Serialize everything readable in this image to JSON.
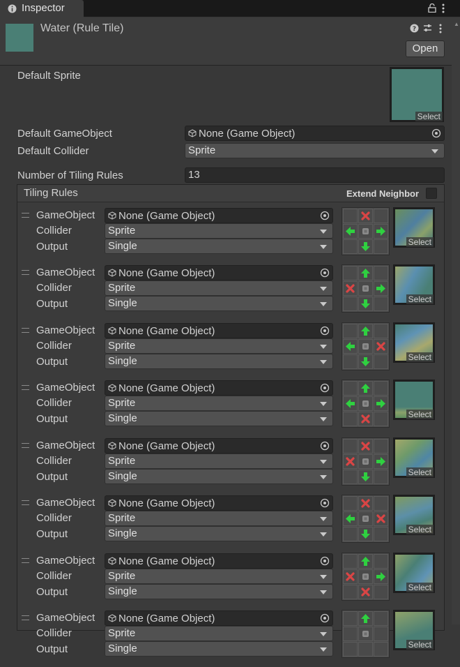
{
  "tab": {
    "label": "Inspector",
    "lock_icon": "lock-icon",
    "menu_icon": "kebab-menu-icon"
  },
  "header": {
    "title": "Water (Rule Tile)",
    "open_label": "Open",
    "icons": [
      "help-icon",
      "presets-icon",
      "kebab-menu-icon"
    ],
    "thumb_color": "#4a7f75"
  },
  "fields": {
    "default_sprite_label": "Default Sprite",
    "default_gameobject_label": "Default GameObject",
    "default_gameobject_value": "None (Game Object)",
    "default_collider_label": "Default Collider",
    "default_collider_value": "Sprite",
    "num_rules_label": "Number of Tiling Rules",
    "num_rules_value": "13",
    "select_label": "Select"
  },
  "rules_section": {
    "title": "Tiling Rules",
    "extend_label": "Extend Neighbor",
    "extend_checked": false
  },
  "rule_labels": {
    "gameobject": "GameObject",
    "collider": "Collider",
    "output": "Output"
  },
  "rules": [
    {
      "gameobject": "None (Game Object)",
      "collider": "Sprite",
      "output": "Single",
      "select": "Select",
      "neighbors": [
        "none",
        "x",
        "none",
        "arrow-left",
        "center",
        "arrow-right",
        "none",
        "arrow-down",
        "none"
      ],
      "sprite": "water-edge-1"
    },
    {
      "gameobject": "None (Game Object)",
      "collider": "Sprite",
      "output": "Single",
      "select": "Select",
      "neighbors": [
        "none",
        "arrow-up",
        "none",
        "x",
        "center",
        "arrow-right",
        "none",
        "arrow-down",
        "none"
      ],
      "sprite": "water-edge-2"
    },
    {
      "gameobject": "None (Game Object)",
      "collider": "Sprite",
      "output": "Single",
      "select": "Select",
      "neighbors": [
        "none",
        "arrow-up",
        "none",
        "arrow-left",
        "center",
        "x",
        "none",
        "arrow-down",
        "none"
      ],
      "sprite": "water-edge-3"
    },
    {
      "gameobject": "None (Game Object)",
      "collider": "Sprite",
      "output": "Single",
      "select": "Select",
      "neighbors": [
        "none",
        "arrow-up",
        "none",
        "arrow-left",
        "center",
        "arrow-right",
        "none",
        "x",
        "none"
      ],
      "sprite": "water-edge-4"
    },
    {
      "gameobject": "None (Game Object)",
      "collider": "Sprite",
      "output": "Single",
      "select": "Select",
      "neighbors": [
        "none",
        "x",
        "none",
        "x",
        "center",
        "arrow-right",
        "none",
        "arrow-down",
        "none"
      ],
      "sprite": "water-edge-5"
    },
    {
      "gameobject": "None (Game Object)",
      "collider": "Sprite",
      "output": "Single",
      "select": "Select",
      "neighbors": [
        "none",
        "x",
        "none",
        "arrow-left",
        "center",
        "x",
        "none",
        "arrow-down",
        "none"
      ],
      "sprite": "water-edge-6"
    },
    {
      "gameobject": "None (Game Object)",
      "collider": "Sprite",
      "output": "Single",
      "select": "Select",
      "neighbors": [
        "none",
        "arrow-up",
        "none",
        "x",
        "center",
        "arrow-right",
        "none",
        "x",
        "none"
      ],
      "sprite": "water-edge-7"
    },
    {
      "gameobject": "None (Game Object)",
      "collider": "Sprite",
      "output": "Single",
      "select": "Select",
      "neighbors": [
        "none",
        "arrow-up",
        "none",
        "none",
        "center",
        "none",
        "none",
        "none",
        "none"
      ],
      "sprite": "water-edge-8"
    }
  ],
  "colors": {
    "arrow_green": "#2fd040",
    "x_red": "#d94545",
    "water": "#4a7f75"
  }
}
